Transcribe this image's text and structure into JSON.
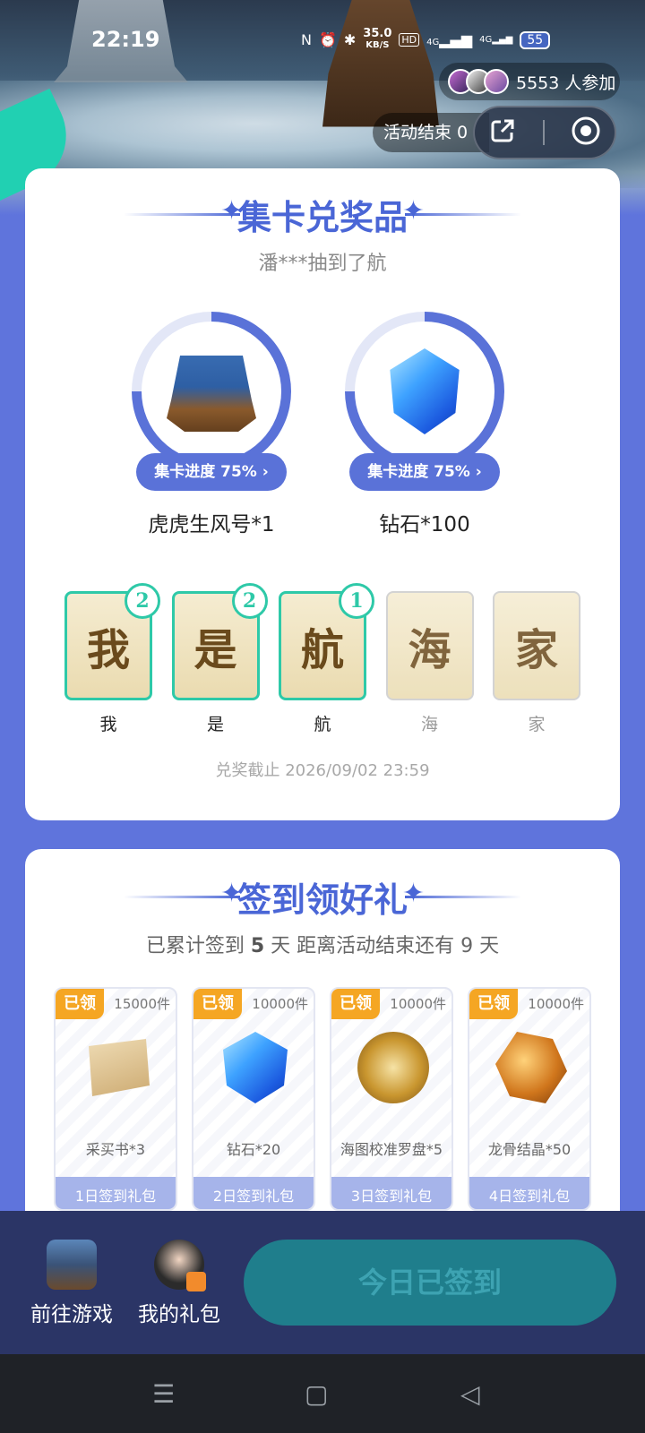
{
  "status": {
    "time": "22:19",
    "net_speed": "35.0",
    "net_unit": "KB/S",
    "battery": "55",
    "network": "4G"
  },
  "header": {
    "participants_count": "5553 人参加",
    "activity_end": "活动结束 0"
  },
  "collect": {
    "title": "集卡兑奖品",
    "ticker": "潘***抽到了航",
    "prizes": [
      {
        "name": "虎虎生风号*1",
        "progress_label": "集卡进度 75%",
        "progress": 0.75
      },
      {
        "name": "钻石*100",
        "progress_label": "集卡进度 75%",
        "progress": 0.75
      }
    ],
    "cards": [
      {
        "char": "我",
        "label": "我",
        "count": "2",
        "owned": true
      },
      {
        "char": "是",
        "label": "是",
        "count": "2",
        "owned": true
      },
      {
        "char": "航",
        "label": "航",
        "count": "1",
        "owned": true
      },
      {
        "char": "海",
        "label": "海",
        "count": "",
        "owned": false
      },
      {
        "char": "家",
        "label": "家",
        "count": "",
        "owned": false
      }
    ],
    "deadline": "兑奖截止 2026/09/02 23:59"
  },
  "signin": {
    "title": "签到领好礼",
    "info_prefix": "已累计签到",
    "info_days": "5",
    "info_suffix": "天  距离活动结束还有 9 天",
    "gifts": [
      {
        "claimed": "已领",
        "count": "15000件",
        "name": "采买书*3",
        "day": "1日签到礼包",
        "icon": "scroll-icon"
      },
      {
        "claimed": "已领",
        "count": "10000件",
        "name": "钻石*20",
        "day": "2日签到礼包",
        "icon": "gem-icon"
      },
      {
        "claimed": "已领",
        "count": "10000件",
        "name": "海图校准罗盘*5",
        "day": "3日签到礼包",
        "icon": "compass-icon"
      },
      {
        "claimed": "已领",
        "count": "10000件",
        "name": "龙骨结晶*50",
        "day": "4日签到礼包",
        "icon": "crystal-icon"
      }
    ]
  },
  "bottom": {
    "go_game": "前往游戏",
    "my_gifts": "我的礼包",
    "signed_today": "今日已签到"
  },
  "colors": {
    "accent": "#5a72d8",
    "teal": "#2ec9a8",
    "claimed": "#f5a623",
    "bottom_bg": "#2b3566"
  }
}
